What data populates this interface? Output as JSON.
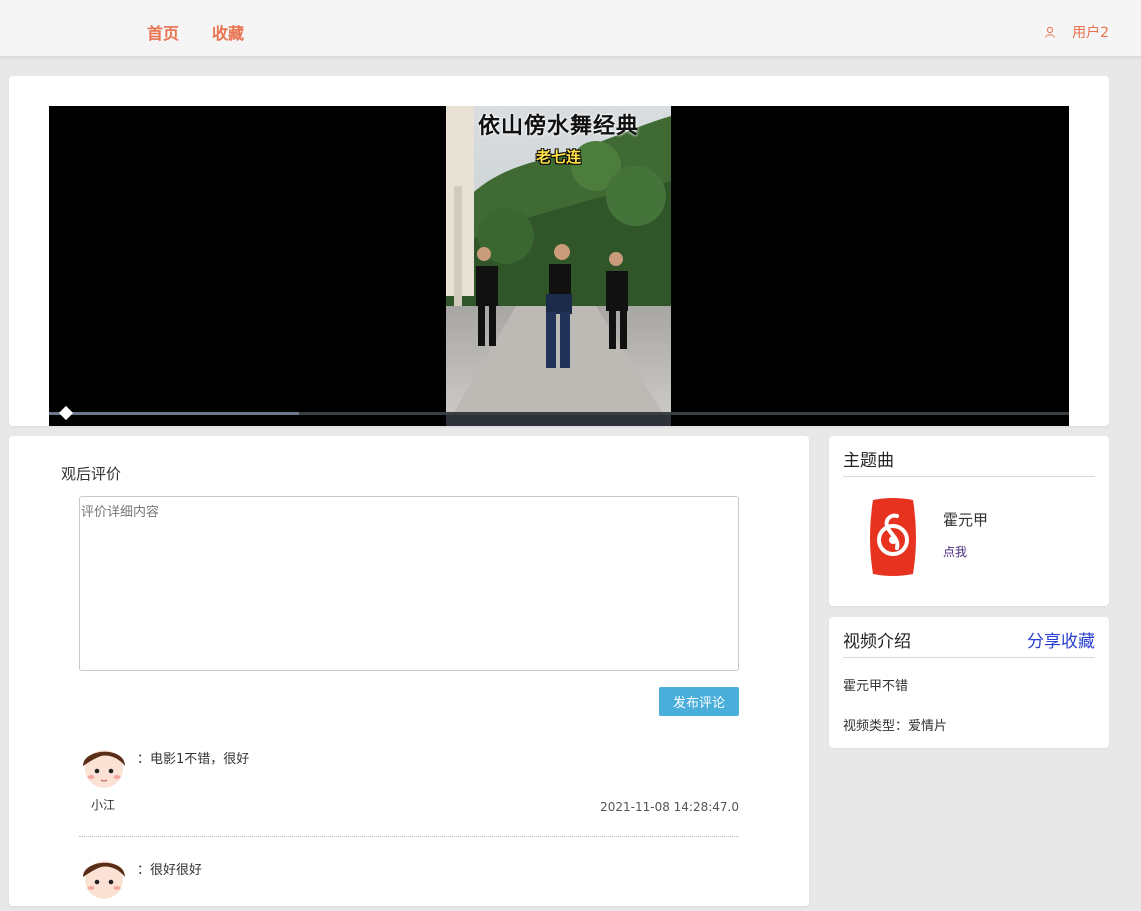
{
  "nav": {
    "home": "首页",
    "favorites": "收藏",
    "user": "用户2"
  },
  "video": {
    "title": "依山傍水舞经典",
    "subtitle": "老七连",
    "progress_percent": 24.5
  },
  "comments_section": {
    "heading": "观后评价",
    "placeholder": "评价详细内容",
    "submit_label": "发布评论",
    "items": [
      {
        "user": "小江",
        "text": "：电影1不错，很好",
        "time": "2021-11-08 14:28:47.0"
      },
      {
        "user": "",
        "text": "：很好很好",
        "time": ""
      }
    ]
  },
  "theme_song": {
    "title": "主题曲",
    "artist": "霍元甲",
    "link": "点我"
  },
  "intro": {
    "title": "视频介绍",
    "share_fav": "分享收藏",
    "description": "霍元甲不错",
    "type_label": "视频类型：爱情片"
  },
  "colors": {
    "accent": "#e9724f",
    "button": "#4aaedb",
    "link_blue": "#2a3fd1"
  }
}
